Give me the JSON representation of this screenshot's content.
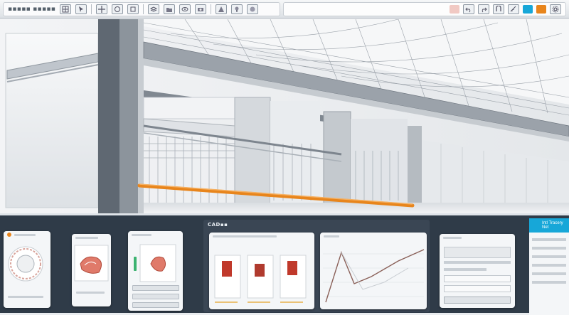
{
  "window": {
    "toolbar_title": "▪▪▪▪▪ ▪▪▪▪▪"
  },
  "toolbar": {
    "left_buttons": [
      "grid-icon",
      "select-icon",
      "move-icon",
      "rotate-icon",
      "scale-icon",
      "layers-icon",
      "folder-icon",
      "view-icon",
      "camera-icon",
      "render-icon",
      "light-icon",
      "material-icon"
    ],
    "right_buttons": [
      "undo-icon",
      "redo-icon",
      "snap-icon",
      "measure-icon",
      "settings-icon"
    ]
  },
  "colors": {
    "accent_blue": "#17a7d8",
    "accent_orange": "#e8851c",
    "accent_red": "#d84a3a",
    "panel_bg": "#2f3b48",
    "toolbar_bg": "#dde1e5"
  },
  "panels": {
    "wide_panel_title": "CAD▪▪",
    "blue_panel_header": "Intl Tracery Net"
  }
}
